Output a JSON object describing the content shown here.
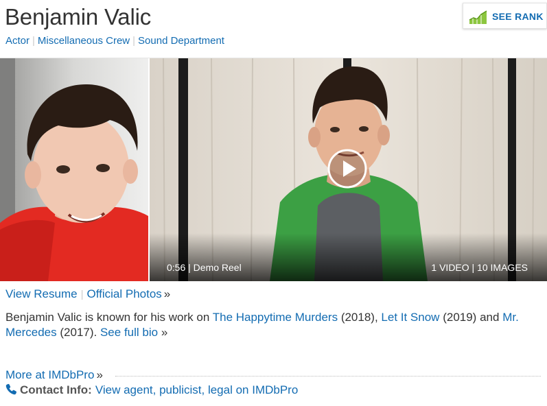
{
  "person": {
    "name": "Benjamin Valic",
    "job_categories": [
      "Actor",
      "Miscellaneous Crew",
      "Sound Department"
    ]
  },
  "rank_button": {
    "label": "SEE RANK",
    "icon": "chart-up-icon"
  },
  "video": {
    "duration": "0:56",
    "title": "Demo Reel",
    "media_count": "1 VIDEO | 10 IMAGES",
    "play_icon": "play-icon"
  },
  "media_links": {
    "view_resume": "View Resume",
    "official_photos": "Official Photos",
    "raquo": "»"
  },
  "bio": {
    "intro": "Benjamin Valic is known for his work on",
    "films": [
      {
        "title": "The Happytime Murders",
        "year": "(2018)"
      },
      {
        "title": "Let It Snow",
        "year": "(2019)"
      },
      {
        "title": "Mr. Mercedes",
        "year": "(2017)"
      }
    ],
    "and_text": "and",
    "see_full_bio": "See full bio",
    "raquo": "»"
  },
  "imdbpro": {
    "more_label": "More at IMDbPro",
    "raquo": "»",
    "contact_label": "Contact Info:",
    "contact_link": "View agent, publicist, legal on IMDbPro",
    "contact_icon": "phone-icon"
  },
  "colors": {
    "link": "#136cb2",
    "text": "#333333",
    "rank_green": "#8cc63f"
  }
}
